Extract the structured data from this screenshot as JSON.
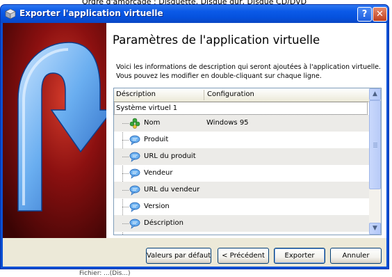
{
  "background": {
    "top_text": "Ordre d'amorçage :   Disquette, Disque dur, Disque CD/DVD",
    "bottom_text": "Fichier: ...(Dis...)"
  },
  "window": {
    "title": "Exporter l'application virtuelle",
    "help_glyph": "?",
    "close_glyph": "✕"
  },
  "page": {
    "title": "Paramètres de l'application virtuelle",
    "description": "Voici les informations de description qui seront ajoutées à l'application virtuelle. Vous pouvez les modifier en double-cliquant sur chaque ligne."
  },
  "tree": {
    "columns": [
      "Déscription",
      "Configuration"
    ],
    "root": "Système virtuel 1",
    "rows": [
      {
        "label": "Nom",
        "value": "Windows 95",
        "icon": "name-puzzle-icon"
      },
      {
        "label": "Produit",
        "value": "",
        "icon": "speech-bubble-icon"
      },
      {
        "label": "URL du produit",
        "value": "",
        "icon": "speech-bubble-icon"
      },
      {
        "label": "Vendeur",
        "value": "",
        "icon": "speech-bubble-icon"
      },
      {
        "label": "URL du vendeur",
        "value": "",
        "icon": "speech-bubble-icon"
      },
      {
        "label": "Version",
        "value": "",
        "icon": "speech-bubble-icon"
      },
      {
        "label": "Déscription",
        "value": "",
        "icon": "speech-bubble-icon"
      }
    ],
    "scroll_up_glyph": "▲",
    "scroll_down_glyph": "▼"
  },
  "buttons": {
    "defaults": "Valeurs par défaut",
    "back": "< Précédent",
    "export": "Exporter",
    "cancel": "Annuler"
  },
  "colors": {
    "titlebar": "#0b5ae8",
    "side_art_red": "#8b1010",
    "arrow_blue": "#4a90e0"
  }
}
